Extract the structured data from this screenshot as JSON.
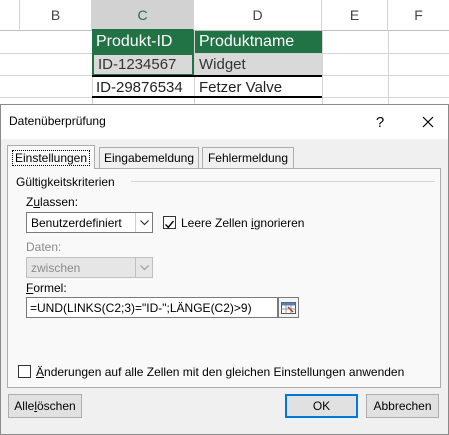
{
  "spreadsheet": {
    "columns": [
      "B",
      "C",
      "D",
      "E",
      "F"
    ],
    "header_row": [
      "Produkt-ID",
      "Produktname"
    ],
    "rows": [
      [
        "ID-1234567",
        "Widget"
      ],
      [
        "ID-29876534",
        "Fetzer Valve"
      ]
    ],
    "colors": {
      "header_bg": "#217346",
      "header_text": "#ffffff",
      "selection": "#d9d9d9"
    }
  },
  "dialog": {
    "title": "Datenüberprüfung",
    "help_glyph": "?",
    "close_glyph": "✕",
    "tabs": [
      "Einstellungen",
      "Eingabemeldung",
      "Fehlermeldung"
    ],
    "active_tab": "Einstellungen",
    "group_label": "Gültigkeitskriterien",
    "allow_label_pre": "Z",
    "allow_label_key": "u",
    "allow_label_post": "lassen:",
    "allow_value": "Benutzerdefiniert",
    "ignore_blank": {
      "checked": true,
      "label_pre": "Leere Zellen ",
      "label_key": "i",
      "label_post": "gnorieren"
    },
    "data_label": "Daten:",
    "data_value": "zwischen",
    "formula_label_key": "F",
    "formula_label_post": "ormel:",
    "formula_value": "=UND(LINKS(C2;3)=\"ID-\";LÄNGE(C2)>9)",
    "apply_all": {
      "checked": false,
      "label_key": "Ä",
      "label_post": "nderungen auf alle Zellen mit den gleichen Einstellungen anwenden"
    },
    "buttons": {
      "clear_all_pre": "Alle ",
      "clear_all_key": "l",
      "clear_all_post": "öschen",
      "ok": "OK",
      "cancel": "Abbrechen"
    },
    "accent_color": "#0078d7"
  }
}
